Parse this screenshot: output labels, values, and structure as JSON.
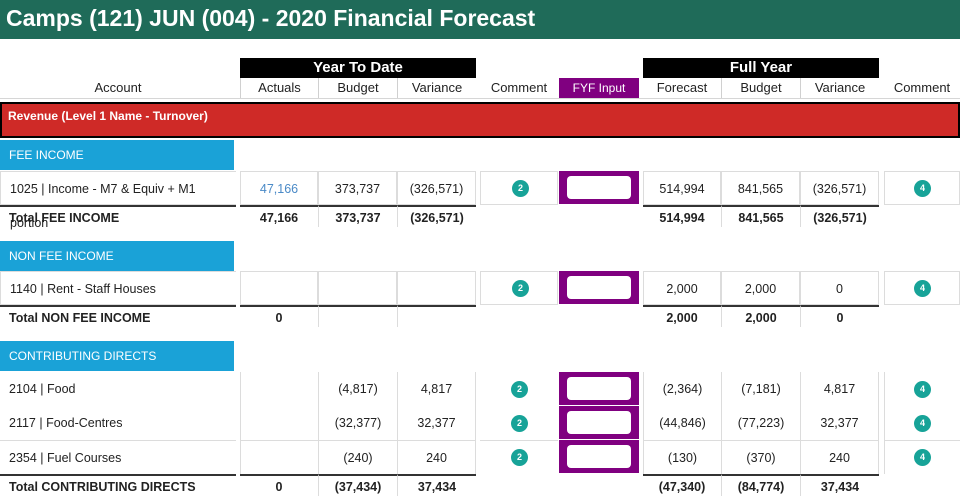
{
  "title": "Camps (121) JUN (004) - 2020 Financial Forecast",
  "header": {
    "ytd_group": "Year To Date",
    "fy_group": "Full Year",
    "account": "Account",
    "actuals": "Actuals",
    "budget": "Budget",
    "variance": "Variance",
    "comment": "Comment",
    "fyf_input": "FYF Input",
    "forecast": "Forecast",
    "fy_budget": "Budget",
    "fy_variance": "Variance",
    "fy_comment": "Comment"
  },
  "revenue_label": "Revenue (Level 1 Name - Turnover)",
  "sections": [
    {
      "name": "FEE INCOME",
      "rows": [
        {
          "account": "1025 | Income - M7 & Equiv + M1 portion",
          "actuals": "47,166",
          "budget": "373,737",
          "variance": "(326,571)",
          "comment_count": "2",
          "forecast": "514,994",
          "fy_budget": "841,565",
          "fy_variance": "(326,571)",
          "fy_comment_count": "4"
        }
      ],
      "total": {
        "label": "Total FEE INCOME",
        "actuals": "47,166",
        "budget": "373,737",
        "variance": "(326,571)",
        "forecast": "514,994",
        "fy_budget": "841,565",
        "fy_variance": "(326,571)"
      }
    },
    {
      "name": "NON FEE INCOME",
      "rows": [
        {
          "account": "1140 | Rent - Staff Houses",
          "actuals": "",
          "budget": "",
          "variance": "",
          "comment_count": "2",
          "forecast": "2,000",
          "fy_budget": "2,000",
          "fy_variance": "0",
          "fy_comment_count": "4"
        }
      ],
      "total": {
        "label": "Total NON FEE INCOME",
        "actuals": "0",
        "budget": "",
        "variance": "",
        "forecast": "2,000",
        "fy_budget": "2,000",
        "fy_variance": "0"
      }
    },
    {
      "name": "CONTRIBUTING DIRECTS",
      "rows": [
        {
          "account": "2104 | Food",
          "actuals": "",
          "budget": "(4,817)",
          "variance": "4,817",
          "comment_count": "2",
          "forecast": "(2,364)",
          "fy_budget": "(7,181)",
          "fy_variance": "4,817",
          "fy_comment_count": "4"
        },
        {
          "account": "2117 | Food-Centres",
          "actuals": "",
          "budget": "(32,377)",
          "variance": "32,377",
          "comment_count": "2",
          "forecast": "(44,846)",
          "fy_budget": "(77,223)",
          "fy_variance": "32,377",
          "fy_comment_count": "4"
        },
        {
          "account": "2354 | Fuel Courses",
          "actuals": "",
          "budget": "(240)",
          "variance": "240",
          "comment_count": "2",
          "forecast": "(130)",
          "fy_budget": "(370)",
          "fy_variance": "240",
          "fy_comment_count": "4"
        }
      ],
      "total": {
        "label": "Total CONTRIBUTING DIRECTS",
        "actuals": "0",
        "budget": "(37,434)",
        "variance": "37,434",
        "forecast": "(47,340)",
        "fy_budget": "(84,774)",
        "fy_variance": "37,434"
      }
    }
  ],
  "colors": {
    "title_bg": "#1f6b59",
    "revenue_bg": "#cf2a27",
    "section_bg": "#1aa2d7",
    "fyf_bg": "#800080",
    "badge_bg": "#17a398"
  }
}
